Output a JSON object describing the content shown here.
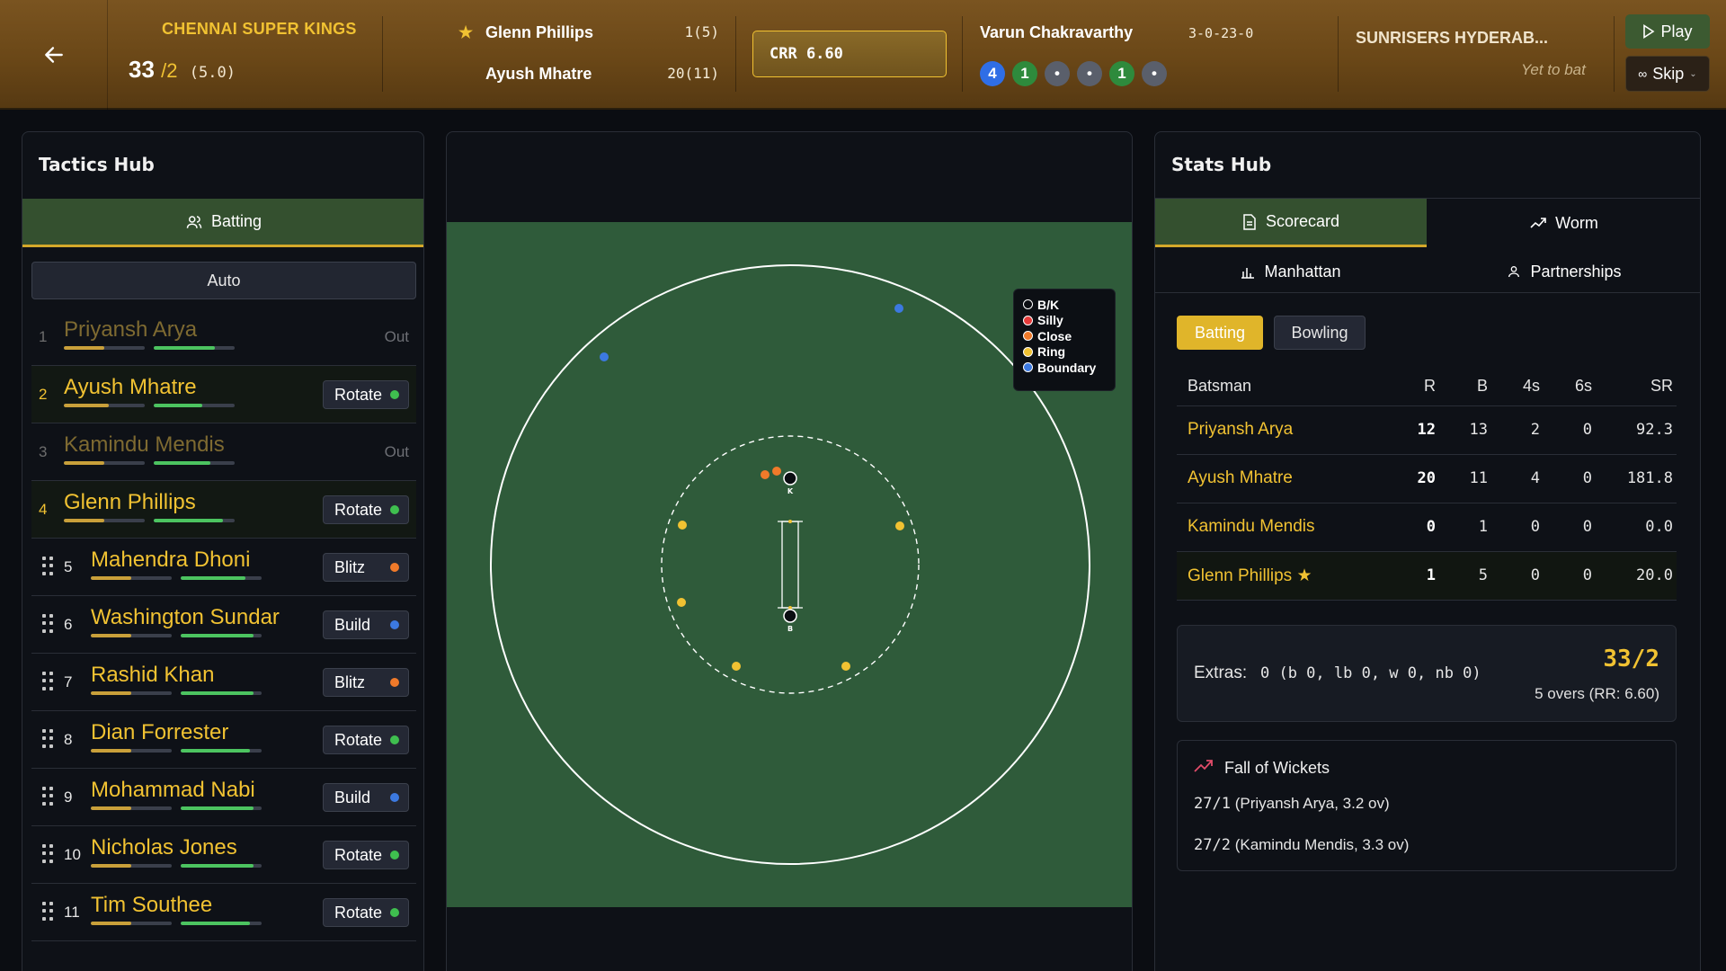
{
  "header": {
    "team": "CHENNAI SUPER KINGS",
    "runs": "33",
    "wickets": "/2",
    "overs": "(5.0)",
    "batters": [
      {
        "name": "Glenn Phillips",
        "figures": "1(5)",
        "on_strike": true
      },
      {
        "name": "Ayush Mhatre",
        "figures": "20(11)",
        "on_strike": false
      }
    ],
    "crr": "CRR 6.60",
    "bowler": {
      "name": "Varun Chakravarthy",
      "figures": "3-0-23-0"
    },
    "recent_balls": [
      {
        "label": "4",
        "color": "#2f6ee6"
      },
      {
        "label": "1",
        "color": "#2e8a3c"
      },
      {
        "label": "•",
        "color": "#5a5f6b"
      },
      {
        "label": "•",
        "color": "#5a5f6b"
      },
      {
        "label": "1",
        "color": "#2e8a3c"
      },
      {
        "label": "•",
        "color": "#5a5f6b"
      }
    ],
    "opponent": "SUNRISERS HYDERAB...",
    "opponent_status": "Yet to bat",
    "play_label": "Play",
    "skip_label": "Skip"
  },
  "tactics": {
    "title": "Tactics Hub",
    "tab": "Batting",
    "auto_label": "Auto",
    "out_label": "Out",
    "batsmen": [
      {
        "num": "1",
        "name": "Priyansh Arya",
        "out": true,
        "mode": "",
        "bar1": 0.5,
        "bar2": 0.75
      },
      {
        "num": "2",
        "name": "Ayush Mhatre",
        "out": false,
        "mode": "Rotate",
        "dot": "#3fbf4f",
        "bar1": 0.55,
        "bar2": 0.6
      },
      {
        "num": "3",
        "name": "Kamindu Mendis",
        "out": true,
        "mode": "",
        "bar1": 0.5,
        "bar2": 0.7
      },
      {
        "num": "4",
        "name": "Glenn Phillips",
        "out": false,
        "mode": "Rotate",
        "dot": "#3fbf4f",
        "bar1": 0.5,
        "bar2": 0.85
      },
      {
        "num": "5",
        "name": "Mahendra Dhoni",
        "out": false,
        "mode": "Blitz",
        "dot": "#f07a2a",
        "bar1": 0.5,
        "bar2": 0.8,
        "drag": true
      },
      {
        "num": "6",
        "name": "Washington Sundar",
        "out": false,
        "mode": "Build",
        "dot": "#3c79e0",
        "bar1": 0.5,
        "bar2": 0.9,
        "drag": true
      },
      {
        "num": "7",
        "name": "Rashid Khan",
        "out": false,
        "mode": "Blitz",
        "dot": "#f07a2a",
        "bar1": 0.5,
        "bar2": 0.9,
        "drag": true
      },
      {
        "num": "8",
        "name": "Dian Forrester",
        "out": false,
        "mode": "Rotate",
        "dot": "#3fbf4f",
        "bar1": 0.5,
        "bar2": 0.85,
        "drag": true
      },
      {
        "num": "9",
        "name": "Mohammad Nabi",
        "out": false,
        "mode": "Build",
        "dot": "#3c79e0",
        "bar1": 0.5,
        "bar2": 0.9,
        "drag": true
      },
      {
        "num": "10",
        "name": "Nicholas Jones",
        "out": false,
        "mode": "Rotate",
        "dot": "#3fbf4f",
        "bar1": 0.5,
        "bar2": 0.9,
        "drag": true
      },
      {
        "num": "11",
        "name": "Tim Southee",
        "out": false,
        "mode": "Rotate",
        "dot": "#3fbf4f",
        "bar1": 0.5,
        "bar2": 0.85,
        "drag": true
      }
    ]
  },
  "field": {
    "legend": [
      {
        "label": "B/K",
        "color": "#0b0d12"
      },
      {
        "label": "Silly",
        "color": "#e53a3a"
      },
      {
        "label": "Close",
        "color": "#f07a2a"
      },
      {
        "label": "Ring",
        "color": "#f1c232"
      },
      {
        "label": "Boundary",
        "color": "#3c79e0"
      }
    ],
    "keeper_label": "K",
    "bowler_label": "B"
  },
  "stats": {
    "title": "Stats Hub",
    "tabs": [
      "Scorecard",
      "Worm",
      "Manhattan",
      "Partnerships"
    ],
    "segment": [
      "Batting",
      "Bowling"
    ],
    "columns": [
      "Batsman",
      "R",
      "B",
      "4s",
      "6s",
      "SR"
    ],
    "rows": [
      {
        "name": "Priyansh Arya",
        "r": "12",
        "b": "13",
        "fours": "2",
        "sixes": "0",
        "sr": "92.3"
      },
      {
        "name": "Ayush Mhatre",
        "r": "20",
        "b": "11",
        "fours": "4",
        "sixes": "0",
        "sr": "181.8"
      },
      {
        "name": "Kamindu Mendis",
        "r": "0",
        "b": "1",
        "fours": "0",
        "sixes": "0",
        "sr": "0.0"
      },
      {
        "name": "Glenn Phillips ★",
        "r": "1",
        "b": "5",
        "fours": "0",
        "sixes": "0",
        "sr": "20.0"
      }
    ],
    "extras_label": "Extras:",
    "extras_value": "0 (b 0, lb 0, w 0, nb 0)",
    "total": "33/2",
    "total_sub": "5 overs (RR: 6.60)",
    "fow_title": "Fall of Wickets",
    "fow": [
      {
        "score": "27/1",
        "detail": "(Priyansh Arya, 3.2 ov)"
      },
      {
        "score": "27/2",
        "detail": "(Kamindu Mendis, 3.3 ov)"
      }
    ]
  }
}
